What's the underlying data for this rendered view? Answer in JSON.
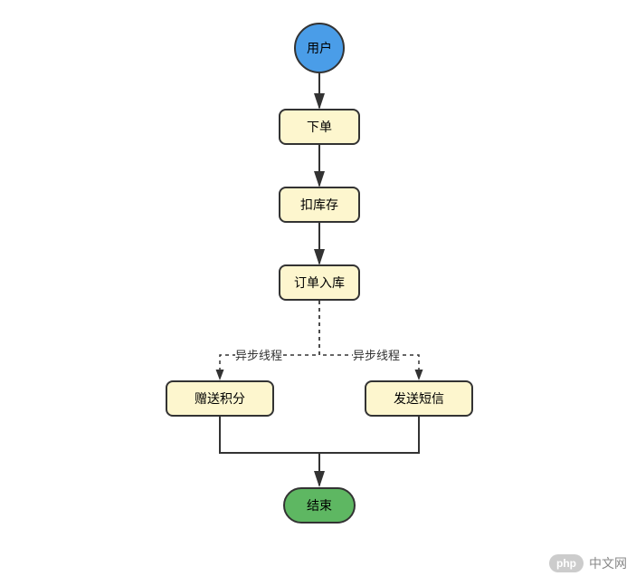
{
  "diagram": {
    "type": "flowchart",
    "nodes": {
      "start": {
        "label": "用户",
        "shape": "ellipse",
        "color": "#4a9de8"
      },
      "step1": {
        "label": "下单",
        "shape": "rounded-rect",
        "color": "#fdf6ce"
      },
      "step2": {
        "label": "扣库存",
        "shape": "rounded-rect",
        "color": "#fdf6ce"
      },
      "step3": {
        "label": "订单入库",
        "shape": "rounded-rect",
        "color": "#fdf6ce"
      },
      "branchA": {
        "label": "赠送积分",
        "shape": "rounded-rect",
        "color": "#fdf6ce"
      },
      "branchB": {
        "label": "发送短信",
        "shape": "rounded-rect",
        "color": "#fdf6ce"
      },
      "end": {
        "label": "结束",
        "shape": "rounded-pill",
        "color": "#5eb762"
      }
    },
    "edges": [
      {
        "from": "start",
        "to": "step1",
        "style": "solid"
      },
      {
        "from": "step1",
        "to": "step2",
        "style": "solid"
      },
      {
        "from": "step2",
        "to": "step3",
        "style": "solid"
      },
      {
        "from": "step3",
        "to": "branchA",
        "style": "dashed",
        "label": "异步线程"
      },
      {
        "from": "step3",
        "to": "branchB",
        "style": "dashed",
        "label": "异步线程"
      },
      {
        "from": "branchA",
        "to": "end",
        "style": "solid"
      },
      {
        "from": "branchB",
        "to": "end",
        "style": "solid"
      }
    ]
  },
  "watermark": {
    "logo": "php",
    "text": "中文网"
  }
}
